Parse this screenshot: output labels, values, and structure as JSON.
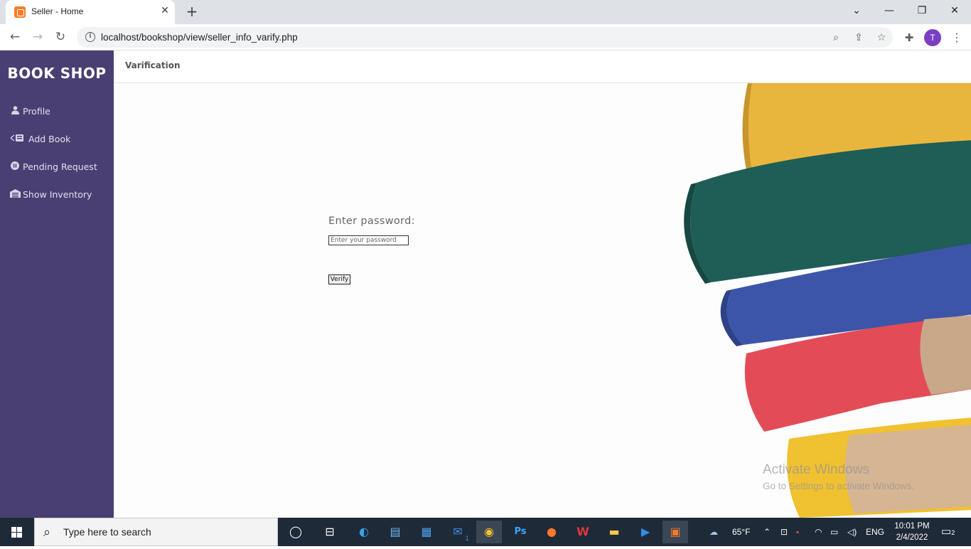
{
  "browser": {
    "tab_title": "Seller - Home",
    "url": "localhost/bookshop/view/seller_info_varify.php",
    "profile_initial": "T"
  },
  "sidebar": {
    "brand": "BOOK SHOP",
    "items": [
      {
        "label": "Profile",
        "icon": "user-icon"
      },
      {
        "label": "Add Book",
        "icon": "add-book-icon"
      },
      {
        "label": "Pending Request",
        "icon": "pause-circle-icon"
      },
      {
        "label": "Show Inventory",
        "icon": "warehouse-icon"
      }
    ]
  },
  "header": {
    "title": "Varification"
  },
  "form": {
    "label": "Enter password:",
    "placeholder": "Enter your password",
    "submit_label": "Verify"
  },
  "watermark": {
    "line1": "Activate Windows",
    "line2": "Go to Settings to activate Windows."
  },
  "taskbar": {
    "search_placeholder": "Type here to search",
    "weather": "65°F",
    "language": "ENG",
    "time": "10:01 PM",
    "date": "2/4/2022",
    "notification_count": "2",
    "mail_badge": "1"
  },
  "colors": {
    "sidebar_bg": "#4a3f72",
    "brand_text": "#ffffff"
  }
}
